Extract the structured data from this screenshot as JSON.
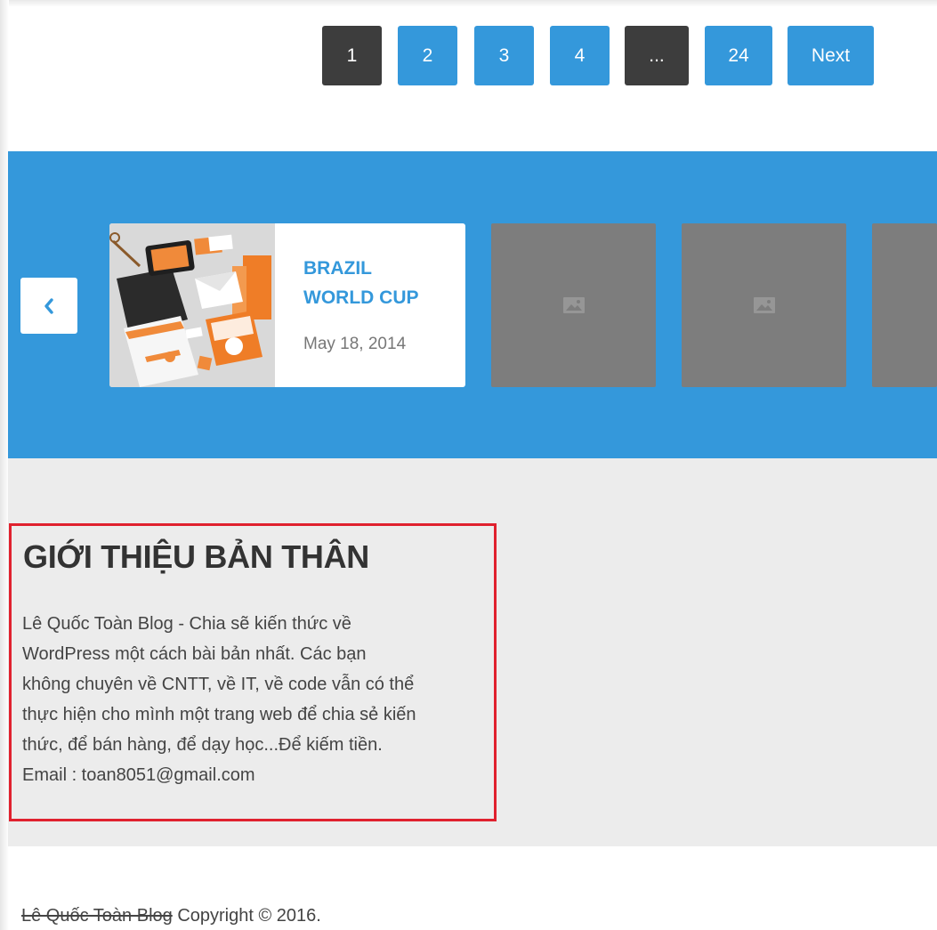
{
  "pagination": {
    "pages": [
      "1",
      "2",
      "3",
      "4",
      "...",
      "24"
    ],
    "current": "1",
    "next_label": "Next"
  },
  "carousel": {
    "post": {
      "title_line1": "BRAZIL",
      "title_line2": "WORLD CUP",
      "date": "May 18, 2014"
    },
    "prev_icon": "chevron-left-icon",
    "placeholder_icon": "image-icon"
  },
  "about": {
    "title": "GIỚI THIỆU BẢN THÂN",
    "lines": [
      "Lê Quốc Toàn Blog - Chia sẽ kiến thức về",
      "WordPress một cách bài bản nhất. Các bạn",
      "không chuyên về CNTT, về IT, về code vẫn có thể",
      "thực hiện cho mình một trang web để chia sẻ kiến",
      "thức, để bán hàng, để dạy học...Để kiếm tiền.",
      "Email : toan8051@gmail.com"
    ]
  },
  "footer": {
    "site_name": "Lê Quốc Toàn Blog",
    "copyright": "Copyright © 2016."
  },
  "colors": {
    "accent": "#3498db",
    "dark_button": "#3d3d3d",
    "highlight_border": "#e0212e",
    "widget_bg": "#ececec"
  }
}
